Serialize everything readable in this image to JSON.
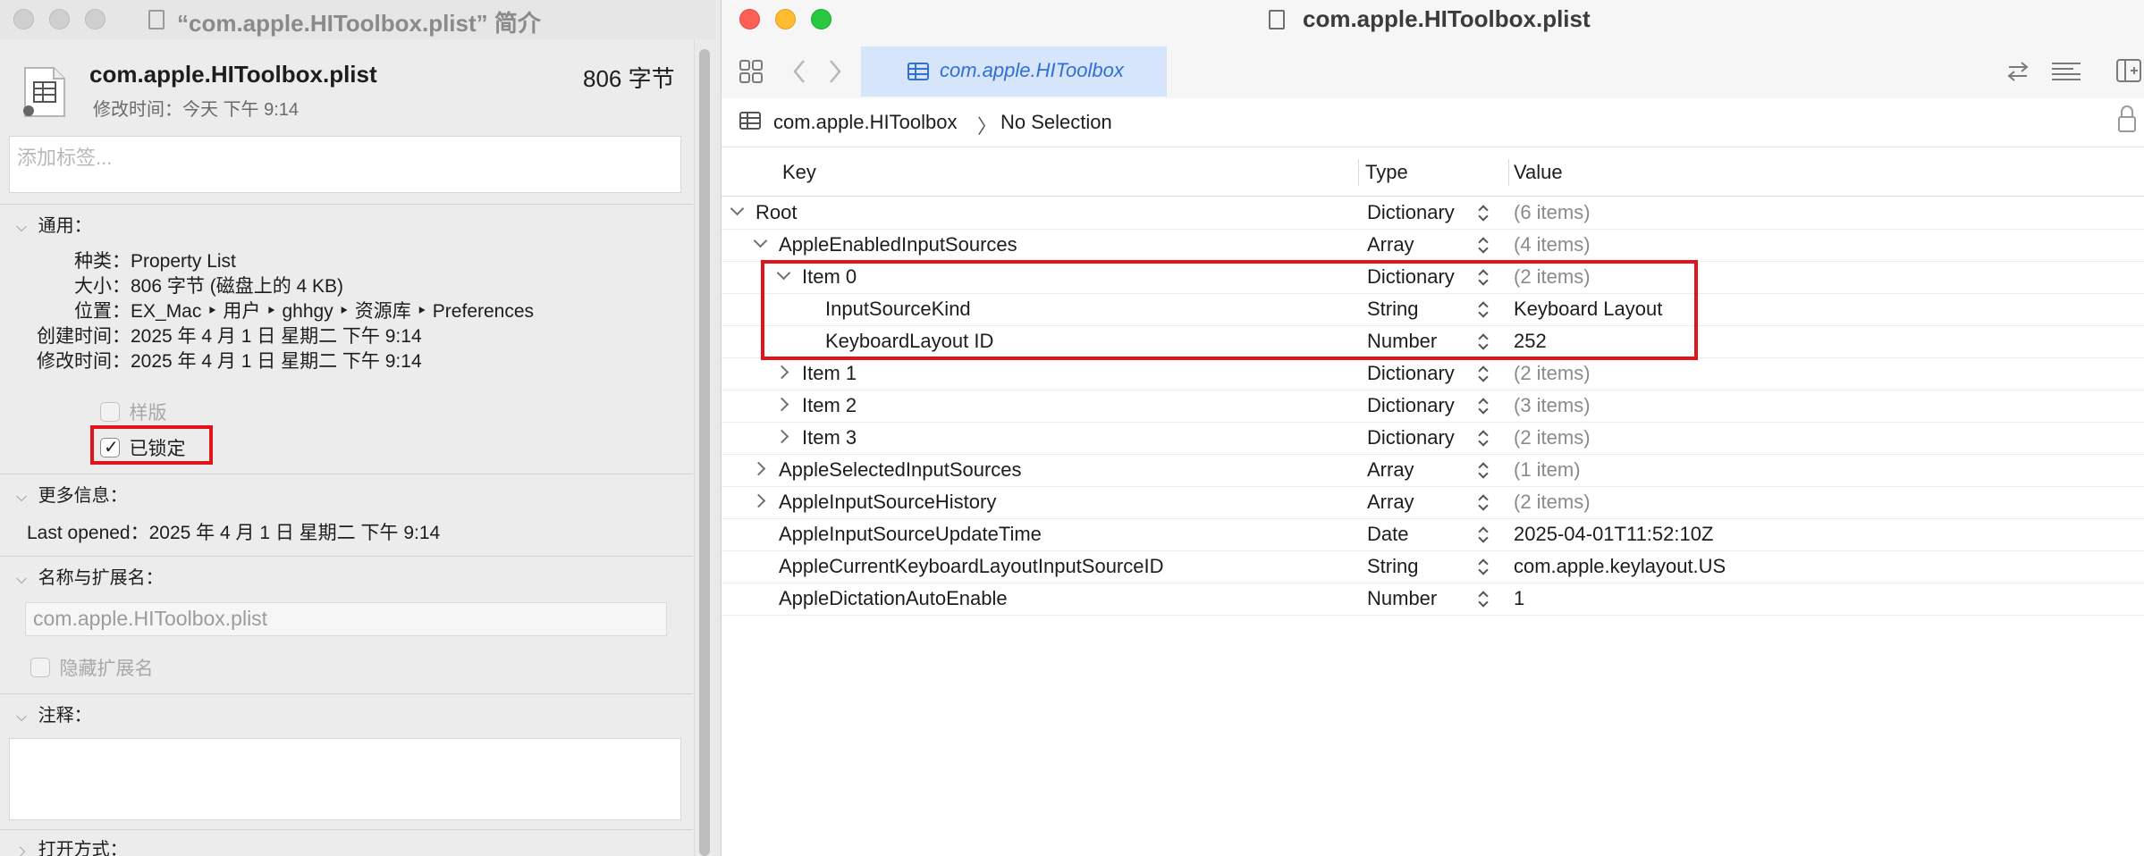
{
  "info_window": {
    "title": "“com.apple.HIToolbox.plist” 简介",
    "file_name": "com.apple.HIToolbox.plist",
    "file_size": "806 字节",
    "modified_short": "修改时间：今天 下午 9:14",
    "tags_placeholder": "添加标签...",
    "general_heading": "通用：",
    "general_fields": [
      {
        "label": "种类：",
        "value": "Property List"
      },
      {
        "label": "大小：",
        "value": "806 字节 (磁盘上的 4 KB)"
      },
      {
        "label": "位置：",
        "value": "EX_Mac ‣ 用户 ‣ ghhgy ‣ 资源库 ‣ Preferences"
      },
      {
        "label": "创建时间：",
        "value": "2025 年 4 月 1 日 星期二 下午 9:14"
      },
      {
        "label": "修改时间：",
        "value": "2025 年 4 月 1 日 星期二 下午 9:14"
      }
    ],
    "stationery_label": "样版",
    "locked_label": "已锁定",
    "locked_checked": true,
    "more_info_heading": "更多信息：",
    "last_opened": "Last opened：2025 年 4 月 1 日 星期二 下午 9:14",
    "name_ext_heading": "名称与扩展名：",
    "name_field_value": "com.apple.HIToolbox.plist",
    "hide_ext_label": "隐藏扩展名",
    "comments_heading": "注释：",
    "open_with_heading": "打开方式："
  },
  "editor": {
    "window_title": "com.apple.HIToolbox.plist",
    "tab_label": "com.apple.HIToolbox",
    "breadcrumb_file": "com.apple.HIToolbox",
    "breadcrumb_sep": "〉",
    "breadcrumb_selection": "No Selection",
    "columns": {
      "key": "Key",
      "type": "Type",
      "value": "Value"
    },
    "rows": [
      {
        "key": "Root",
        "type": "Dictionary",
        "value": "(6 items)"
      },
      {
        "key": "AppleEnabledInputSources",
        "type": "Array",
        "value": "(4 items)"
      },
      {
        "key": "Item 0",
        "type": "Dictionary",
        "value": "(2 items)"
      },
      {
        "key": "InputSourceKind",
        "type": "String",
        "value": "Keyboard Layout"
      },
      {
        "key": "KeyboardLayout ID",
        "type": "Number",
        "value": "252"
      },
      {
        "key": "Item 1",
        "type": "Dictionary",
        "value": "(2 items)"
      },
      {
        "key": "Item 2",
        "type": "Dictionary",
        "value": "(3 items)"
      },
      {
        "key": "Item 3",
        "type": "Dictionary",
        "value": "(2 items)"
      },
      {
        "key": "AppleSelectedInputSources",
        "type": "Array",
        "value": "(1 item)"
      },
      {
        "key": "AppleInputSourceHistory",
        "type": "Array",
        "value": "(2 items)"
      },
      {
        "key": "AppleInputSourceUpdateTime",
        "type": "Date",
        "value": "2025-04-01T11:52:10Z"
      },
      {
        "key": "AppleCurrentKeyboardLayoutInputSourceID",
        "type": "String",
        "value": "com.apple.keylayout.US"
      },
      {
        "key": "AppleDictationAutoEnable",
        "type": "Number",
        "value": "1"
      }
    ]
  },
  "colors": {
    "highlight_red": "#e0141a",
    "tab_blue": "#d7e5fb",
    "tab_text_blue": "#2f6fd6",
    "close_red": "#fe5f57",
    "minimize_yellow": "#febc2e",
    "zoom_green": "#28c840"
  },
  "icons": [
    "plist-document-icon",
    "grid-icon",
    "back-chevron-icon",
    "forward-chevron-icon",
    "table-icon",
    "swap-icon",
    "text-align-icon",
    "sidebar-toggle-icon",
    "lock-icon",
    "disclosure-triangle-icon",
    "stepper-icon",
    "checkmark-icon"
  ]
}
